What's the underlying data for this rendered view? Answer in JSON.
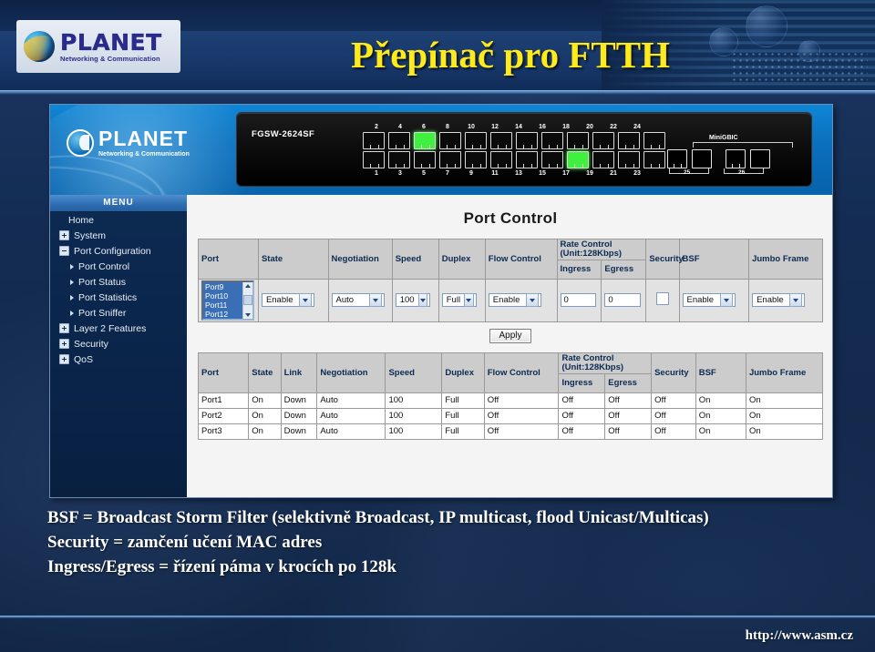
{
  "slide": {
    "title": "Přepínač pro FTTH",
    "brand": {
      "name": "PLANET",
      "tagline": "Networking & Communication"
    },
    "footer_url": "http://www.asm.cz",
    "notes": [
      "BSF = Broadcast Storm Filter  (selektivně Broadcast, IP multicast,  flood Unicast/Multicas)",
      "Security = zamčení učení MAC adres",
      "Ingress/Egress = řízení páma v krocích po 128k"
    ]
  },
  "device": {
    "model": "FGSW-2624SF",
    "top_port_numbers": [
      "2",
      "4",
      "6",
      "8",
      "10",
      "12",
      "14",
      "16",
      "18",
      "20",
      "22",
      "24"
    ],
    "bottom_port_numbers": [
      "1",
      "3",
      "5",
      "7",
      "9",
      "11",
      "13",
      "15",
      "17",
      "19",
      "21",
      "23"
    ],
    "lit_top_index": 2,
    "lit_bottom_index": 8,
    "gbic_label": "MiniGBIC",
    "gbic_port_numbers": [
      "25",
      "26"
    ]
  },
  "menu": {
    "title": "MENU",
    "items": [
      {
        "label": "Home",
        "level": 0,
        "icon": "none"
      },
      {
        "label": "System",
        "level": 1,
        "icon": "plus-box-icon"
      },
      {
        "label": "Port Configuration",
        "level": 1,
        "icon": "minus-box-icon"
      },
      {
        "label": "Port Control",
        "level": 2,
        "icon": "arrow-right-icon"
      },
      {
        "label": "Port Status",
        "level": 2,
        "icon": "arrow-right-icon"
      },
      {
        "label": "Port Statistics",
        "level": 2,
        "icon": "arrow-right-icon"
      },
      {
        "label": "Port Sniffer",
        "level": 2,
        "icon": "arrow-right-icon"
      },
      {
        "label": "Layer 2 Features",
        "level": 1,
        "icon": "plus-box-icon"
      },
      {
        "label": "Security",
        "level": 1,
        "icon": "plus-box-icon"
      },
      {
        "label": "QoS",
        "level": 1,
        "icon": "plus-box-icon"
      }
    ]
  },
  "page": {
    "title": "Port Control",
    "apply_label": "Apply"
  },
  "form_table": {
    "headers": {
      "port": "Port",
      "state": "State",
      "negotiation": "Negotiation",
      "speed": "Speed",
      "duplex": "Duplex",
      "flow_control": "Flow Control",
      "rate_control_line1": "Rate Control",
      "rate_control_line2": "(Unit:128Kbps)",
      "ingress": "Ingress",
      "egress": "Egress",
      "security": "Security",
      "bsf": "BSF",
      "jumbo_frame": "Jumbo Frame"
    },
    "values": {
      "port_options": [
        "Port9",
        "Port10",
        "Port11",
        "Port12"
      ],
      "state": "Enable",
      "negotiation": "Auto",
      "speed": "100",
      "duplex": "Full",
      "flow_control": "Enable",
      "ingress": "0",
      "egress": "0",
      "security_checked": false,
      "bsf": "Enable",
      "jumbo_frame": "Enable"
    }
  },
  "status_table": {
    "headers": {
      "port": "Port",
      "state": "State",
      "link": "Link",
      "negotiation": "Negotiation",
      "speed": "Speed",
      "duplex": "Duplex",
      "flow_control": "Flow Control",
      "rate_control_line1": "Rate Control",
      "rate_control_line2": "(Unit:128Kbps)",
      "ingress": "Ingress",
      "egress": "Egress",
      "security": "Security",
      "bsf": "BSF",
      "jumbo_frame": "Jumbo Frame"
    },
    "rows": [
      {
        "port": "Port1",
        "state": "On",
        "link": "Down",
        "negotiation": "Auto",
        "speed": "100",
        "duplex": "Full",
        "flow_control": "Off",
        "ingress": "Off",
        "egress": "Off",
        "security": "Off",
        "bsf": "On",
        "jumbo_frame": "On"
      },
      {
        "port": "Port2",
        "state": "On",
        "link": "Down",
        "negotiation": "Auto",
        "speed": "100",
        "duplex": "Full",
        "flow_control": "Off",
        "ingress": "Off",
        "egress": "Off",
        "security": "Off",
        "bsf": "On",
        "jumbo_frame": "On"
      },
      {
        "port": "Port3",
        "state": "On",
        "link": "Down",
        "negotiation": "Auto",
        "speed": "100",
        "duplex": "Full",
        "flow_control": "Off",
        "ingress": "Off",
        "egress": "Off",
        "security": "Off",
        "bsf": "On",
        "jumbo_frame": "On"
      }
    ]
  },
  "colors": {
    "slide_bg": "#13294c",
    "title_yellow": "#ffeb1c",
    "ui_header_blue": "#0a6fbe",
    "menu_bg": "#0a2449",
    "table_header_gray": "#cccccc",
    "link_green": "#3ff03f"
  }
}
